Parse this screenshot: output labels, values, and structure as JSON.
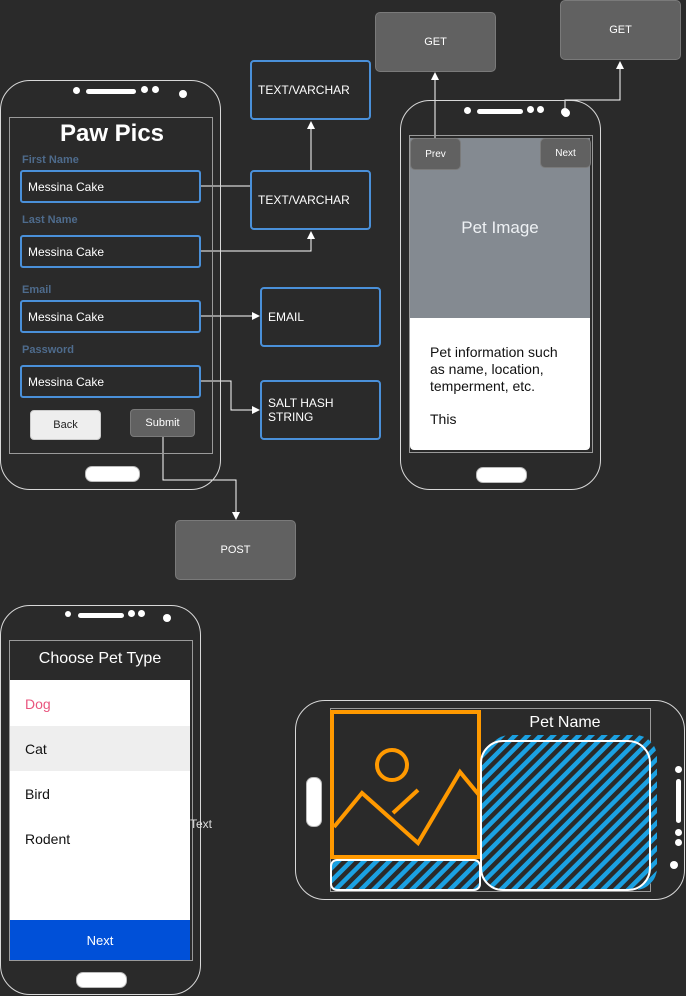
{
  "signup": {
    "title": "Paw Pics",
    "fields": [
      {
        "label": "First Name",
        "value": "Messina Cake"
      },
      {
        "label": "Last Name",
        "value": "Messina Cake"
      },
      {
        "label": "Email",
        "value": "Messina Cake"
      },
      {
        "label": "Password",
        "value": "Messina Cake"
      }
    ],
    "back_label": "Back",
    "submit_label": "Submit"
  },
  "db_fields": {
    "first_name_type": "TEXT/VARCHAR",
    "last_name_type": "TEXT/VARCHAR",
    "email_type": "EMAIL",
    "password_type": "SALT HASH STRING"
  },
  "requests": {
    "post_label": "POST",
    "get_prev_label": "GET",
    "get_next_label": "GET"
  },
  "viewer": {
    "prev_label": "Prev",
    "next_label": "Next",
    "image_placeholder": "Pet Image",
    "info_line1": "Pet information such as name, location, temperment, etc.",
    "info_line2": "This"
  },
  "pet_type": {
    "title": "Choose Pet Type",
    "options": [
      "Dog",
      "Cat",
      "Bird",
      "Rodent"
    ],
    "selected": "Dog",
    "next_label": "Next",
    "floating_text": "Text"
  },
  "landscape": {
    "pet_name": "Pet Name"
  },
  "colors": {
    "blue_border": "#4a90d9",
    "selected_pink": "#e9557e",
    "next_blue": "#0050d8",
    "orange": "#ff9900",
    "hatch_blue": "#1ba1e2"
  }
}
